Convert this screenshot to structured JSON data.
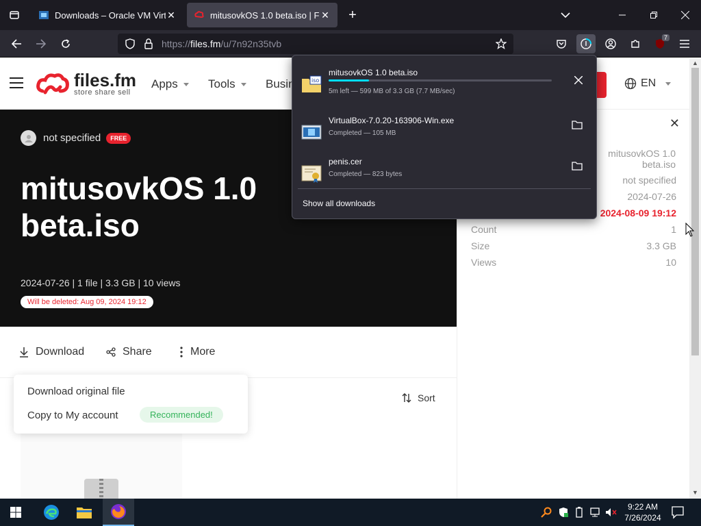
{
  "browser": {
    "tabs": [
      {
        "title": "Downloads – Oracle VM VirtualBox",
        "active": false
      },
      {
        "title": "mitusovkOS 1.0 beta.iso | Files.fm",
        "active": true
      }
    ],
    "url_prefix": "https://",
    "url_host": "files.fm",
    "url_path": "/u/7n92n35tvb",
    "extension_badge": "7"
  },
  "site": {
    "logo_name": "files.fm",
    "logo_sub": "store share sell",
    "nav": [
      "Apps",
      "Tools",
      "Busin"
    ],
    "language": "EN"
  },
  "hero": {
    "owner": "not specified",
    "owner_badge": "FREE",
    "title": "mitusovkOS 1.0 beta.iso",
    "meta": "2024-07-26 | 1 file | 3.3 GB | 10 views",
    "delete_notice": "Will be deleted: Aug 09, 2024 19:12"
  },
  "actions": {
    "download": "Download",
    "share": "Share",
    "more": "More",
    "sort": "Sort"
  },
  "dropdown": {
    "item1": "Download original file",
    "item2": "Copy to My account",
    "badge": "Recommended!"
  },
  "info": {
    "name": "mitusovkOS 1.0 beta.iso",
    "owner": "not specified",
    "created": "2024-07-26",
    "expires": "2024-08-09 19:12",
    "rows": [
      {
        "label": "Count",
        "value": "1"
      },
      {
        "label": "Size",
        "value": "3.3 GB"
      },
      {
        "label": "Views",
        "value": "10"
      }
    ]
  },
  "downloads": {
    "items": [
      {
        "name": "mitusovkOS 1.0 beta.iso",
        "status": "5m left — 599 MB of 3.3 GB (7.7 MB/sec)",
        "progress": 0.18,
        "icon": "iso-file-icon"
      },
      {
        "name": "VirtualBox-7.0.20-163906-Win.exe",
        "status": "Completed — 105 MB",
        "icon": "exe-file-icon"
      },
      {
        "name": "penis.cer",
        "status": "Completed — 823 bytes",
        "icon": "certificate-file-icon"
      }
    ],
    "show_all": "Show all downloads"
  },
  "taskbar": {
    "time": "9:22 AM",
    "date": "7/26/2024"
  },
  "colors": {
    "brand": "#e8232e",
    "progress": "#00ddff",
    "taskbar": "#101a26"
  }
}
